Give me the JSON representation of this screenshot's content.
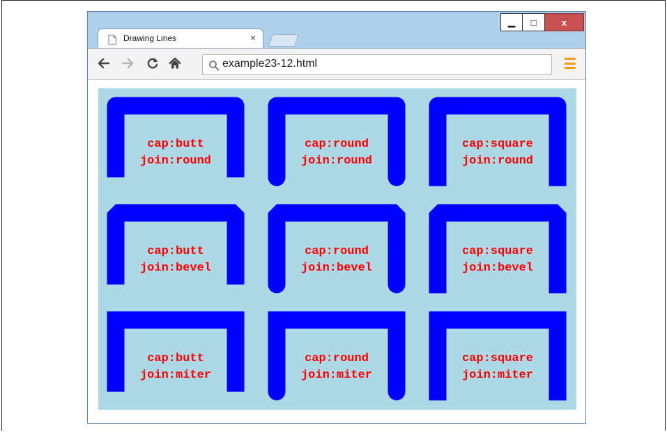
{
  "window": {
    "tab_title": "Drawing Lines",
    "tab_close": "×",
    "minimize_label": "▁",
    "maximize_label": "□",
    "close_label": "x"
  },
  "toolbar": {
    "url": "example23-12.html"
  },
  "icons": {
    "back": "back-arrow-icon",
    "forward": "forward-arrow-icon",
    "reload": "reload-icon",
    "home": "home-icon",
    "search": "search-icon",
    "menu": "menu-icon",
    "page": "page-icon"
  },
  "colors": {
    "canvas_background": "#add8e6",
    "stroke": "#0000ff",
    "label_text": "#ff0000",
    "titlebar": "#afd0ea",
    "close_button": "#c75050",
    "menu_icon": "#f29c1f"
  },
  "canvas": {
    "demos": [
      {
        "cap": "butt",
        "join": "round",
        "line1": "cap:butt",
        "line2": "join:round"
      },
      {
        "cap": "round",
        "join": "round",
        "line1": "cap:round",
        "line2": "join:round"
      },
      {
        "cap": "square",
        "join": "round",
        "line1": "cap:square",
        "line2": "join:round"
      },
      {
        "cap": "butt",
        "join": "bevel",
        "line1": "cap:butt",
        "line2": "join:bevel"
      },
      {
        "cap": "round",
        "join": "bevel",
        "line1": "cap:round",
        "line2": "join:bevel"
      },
      {
        "cap": "square",
        "join": "bevel",
        "line1": "cap:square",
        "line2": "join:bevel"
      },
      {
        "cap": "butt",
        "join": "miter",
        "line1": "cap:butt",
        "line2": "join:miter"
      },
      {
        "cap": "round",
        "join": "miter",
        "line1": "cap:round",
        "line2": "join:miter"
      },
      {
        "cap": "square",
        "join": "miter",
        "line1": "cap:square",
        "line2": "join:miter"
      }
    ]
  }
}
